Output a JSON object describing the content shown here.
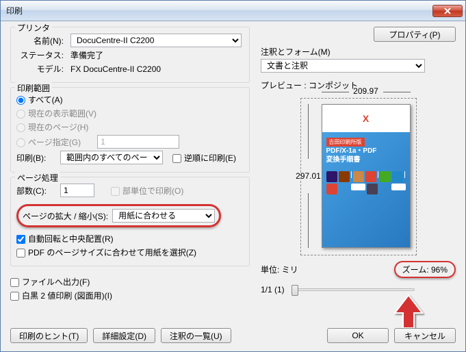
{
  "title": "印刷",
  "printer": {
    "legend": "プリンタ",
    "name_label": "名前(N):",
    "name_value": "DocuCentre-II C2200",
    "properties_button": "プロパティ(P)",
    "status_label": "ステータス:",
    "status_value": "準備完了",
    "model_label": "モデル:",
    "model_value": "FX DocuCentre-II C2200",
    "comments_form_label": "注釈とフォーム(M)",
    "comments_form_value": "文書と注釈"
  },
  "range": {
    "legend": "印刷範囲",
    "all": "すべて(A)",
    "current_view": "現在の表示範囲(V)",
    "current_page": "現在のページ(H)",
    "pages": "ページ指定(G)",
    "pages_value": "1",
    "subset_label": "印刷(B):",
    "subset_value": "範囲内のすべてのページ",
    "reverse": "逆順に印刷(E)"
  },
  "handling": {
    "legend": "ページ処理",
    "copies_label": "部数(C):",
    "copies_value": "1",
    "collate": "部単位で印刷(O)",
    "scaling_label": "ページの拡大 / 縮小(S):",
    "scaling_value": "用紙に合わせる",
    "auto_rotate": "自動回転と中央配置(R)",
    "choose_paper": "PDF のページサイズに合わせて用紙を選択(Z)"
  },
  "output": {
    "file": "ファイルへ出力(F)",
    "bw": "白黒 2 値印刷 (図面用)(I)"
  },
  "preview": {
    "label": "プレビュー : コンポジット",
    "width": "209.97",
    "height": "297.01",
    "units_label": "単位: ミリ",
    "zoom_label": "ズーム: 96%",
    "page_info": "1/1 (1)",
    "doc_header": "X",
    "doc_title1": "吉田印刷所版",
    "doc_title2": "PDF/X-1a・PDF",
    "doc_title3": "変換手順書"
  },
  "buttons": {
    "hint": "印刷のヒント(T)",
    "advanced": "詳細設定(D)",
    "summarize": "注釈の一覧(U)",
    "ok": "OK",
    "cancel": "キャンセル"
  }
}
